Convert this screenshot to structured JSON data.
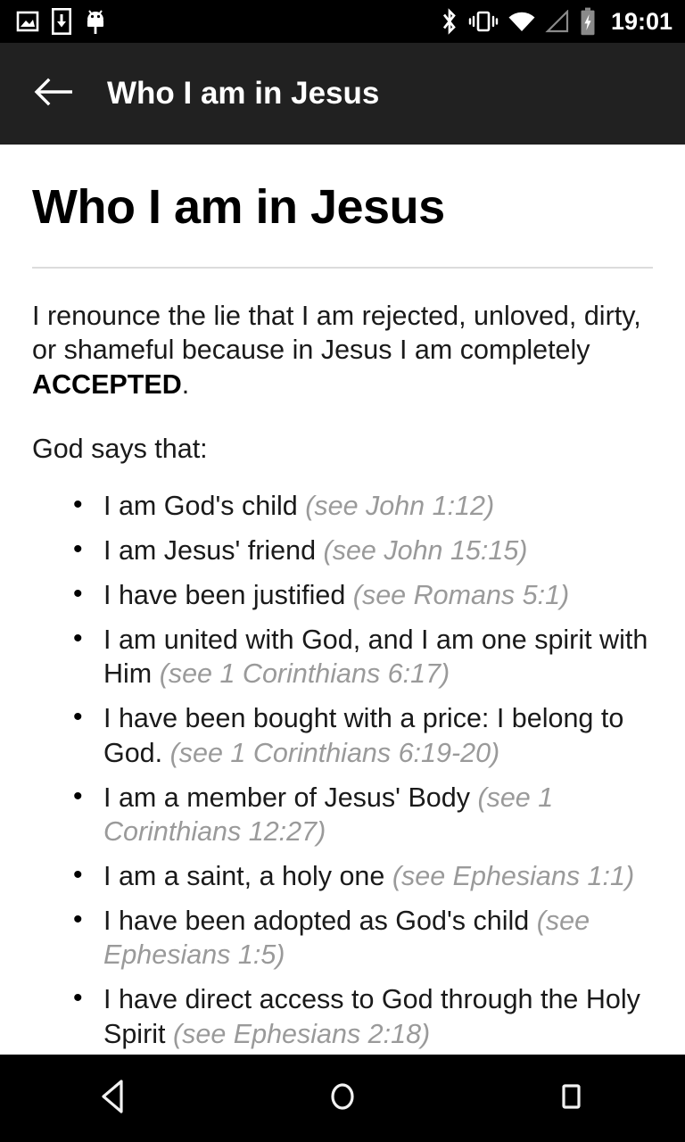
{
  "status_bar": {
    "icons_left": [
      "image-icon",
      "download-icon",
      "android-debug-icon"
    ],
    "icons_right": [
      "bluetooth-icon",
      "vibrate-icon",
      "wifi-icon",
      "cell-signal-icon",
      "battery-charging-icon"
    ],
    "clock": "19:01",
    "background_color": "#000000",
    "icon_color": "#ffffff",
    "dim_icon_color": "#8a8a8a"
  },
  "toolbar": {
    "back_icon": "arrow-left-icon",
    "title": "Who I am in Jesus",
    "background_color": "#212121",
    "text_color": "#ffffff"
  },
  "content": {
    "heading": "Who I am in Jesus",
    "paragraph_1": {
      "before_bold": "I renounce the lie that I am rejected, unloved, dirty, or shameful because in Jesus I am completely ",
      "bold": "ACCEPTED",
      "after_bold": "."
    },
    "paragraph_2": "God says that:",
    "list_items": [
      {
        "text": "I am God's child ",
        "citation": "(see John 1:12)"
      },
      {
        "text": "I am Jesus' friend ",
        "citation": "(see John 15:15)"
      },
      {
        "text": "I have been justified ",
        "citation": "(see Romans 5:1)"
      },
      {
        "text": "I am united with God, and I am one spirit with Him ",
        "citation": "(see 1 Corinthians 6:17)"
      },
      {
        "text": "I have been bought with a price: I belong to God. ",
        "citation": "(see 1 Corinthians 6:19-20)"
      },
      {
        "text": "I am a member of Jesus' Body ",
        "citation": "(see 1 Corinthians 12:27)"
      },
      {
        "text": "I am a saint, a holy one ",
        "citation": "(see Ephesians 1:1)"
      },
      {
        "text": "I have been adopted as God's child ",
        "citation": "(see Ephesians 1:5)"
      },
      {
        "text": "I have direct access to God through the Holy Spirit ",
        "citation": "(see Ephesians 2:18)"
      }
    ],
    "citation_color": "#9a9a9a",
    "text_color": "#1a1a1a",
    "divider_color": "#dcdcdc"
  },
  "nav_bar": {
    "back_icon": "triangle-back-icon",
    "home_icon": "circle-home-icon",
    "recents_icon": "square-recents-icon",
    "background_color": "#000000"
  }
}
